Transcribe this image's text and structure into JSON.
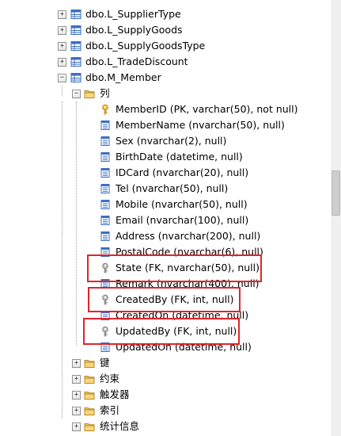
{
  "tree": {
    "tables": [
      {
        "label": "dbo.L_SupplierType",
        "expanded": false
      },
      {
        "label": "dbo.L_SupplyGoods",
        "expanded": false
      },
      {
        "label": "dbo.L_SupplyGoodsType",
        "expanded": false
      },
      {
        "label": "dbo.L_TradeDiscount",
        "expanded": false
      },
      {
        "label": "dbo.M_Member",
        "expanded": true
      }
    ],
    "columns_folder": {
      "label": "列",
      "expanded": true
    },
    "columns": [
      {
        "label": "MemberID (PK, varchar(50), not null)",
        "icon": "primary-key-icon"
      },
      {
        "label": "MemberName (nvarchar(50), null)",
        "icon": "column-icon"
      },
      {
        "label": "Sex (nvarchar(2), null)",
        "icon": "column-icon"
      },
      {
        "label": "BirthDate (datetime, null)",
        "icon": "column-icon"
      },
      {
        "label": "IDCard (nvarchar(20), null)",
        "icon": "column-icon"
      },
      {
        "label": "Tel (nvarchar(50), null)",
        "icon": "column-icon"
      },
      {
        "label": "Mobile (nvarchar(50), null)",
        "icon": "column-icon"
      },
      {
        "label": "Email (nvarchar(100), null)",
        "icon": "column-icon"
      },
      {
        "label": "Address (nvarchar(200), null)",
        "icon": "column-icon"
      },
      {
        "label": "PostalCode (nvarchar(6), null)",
        "icon": "column-icon"
      },
      {
        "label": "State (FK, nvarchar(50), null)",
        "icon": "foreign-key-icon"
      },
      {
        "label": "Remark (nvarchar(400), null)",
        "icon": "column-icon"
      },
      {
        "label": "CreatedBy (FK, int, null)",
        "icon": "foreign-key-icon"
      },
      {
        "label": "CreatedOn (datetime, null)",
        "icon": "column-icon"
      },
      {
        "label": "UpdatedBy (FK, int, null)",
        "icon": "foreign-key-icon"
      },
      {
        "label": "UpdatedOn (datetime, null)",
        "icon": "column-icon"
      }
    ],
    "folders": [
      {
        "label": "键",
        "expanded": false
      },
      {
        "label": "约束",
        "expanded": false
      },
      {
        "label": "触发器",
        "expanded": false
      },
      {
        "label": "索引",
        "expanded": false
      },
      {
        "label": "统计信息",
        "expanded": false
      }
    ],
    "expander_collapsed": "+",
    "expander_expanded": "−"
  },
  "colors": {
    "highlight": "#e0252b",
    "folder": "#f2c55c",
    "key_gold": "#d9a520",
    "key_gray": "#9a9a9a",
    "table_blue": "#3b6fc2"
  }
}
